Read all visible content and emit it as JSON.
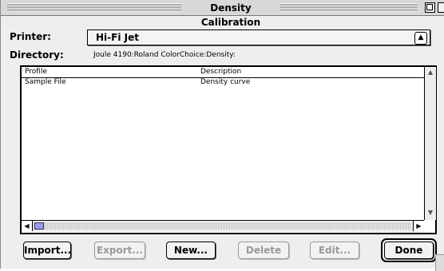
{
  "window": {
    "title": "Density Calibration"
  },
  "printer": {
    "label": "Printer:",
    "value": "Hi-Fi Jet"
  },
  "directory": {
    "label": "Directory:",
    "value": "Joule 4190:Roland ColorChoice:Density:"
  },
  "table": {
    "columns": [
      "Profile",
      "Description"
    ],
    "rows": [
      {
        "profile": "Sample File",
        "description": "Density curve"
      }
    ]
  },
  "buttons": {
    "import": "Import...",
    "export": "Export...",
    "new": "New...",
    "delete": "Delete",
    "edit": "Edit...",
    "done": "Done"
  },
  "states": {
    "export_enabled": false,
    "delete_enabled": false,
    "edit_enabled": false
  }
}
